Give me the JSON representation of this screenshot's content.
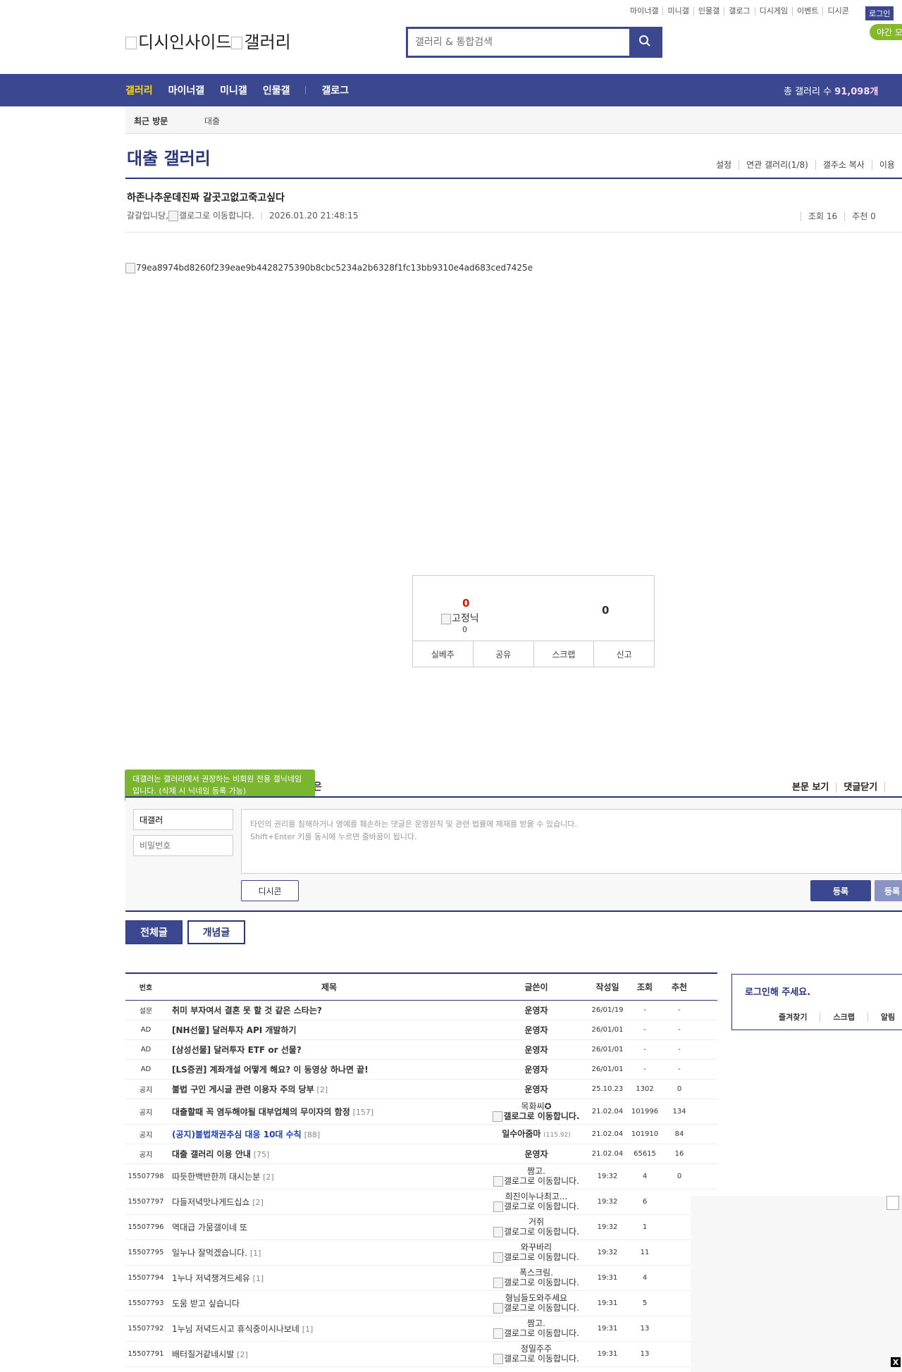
{
  "header": {
    "top_links": [
      "마이너갤",
      "미니갤",
      "인물갤",
      "갤로그",
      "디시게임",
      "이벤트",
      "디시콘"
    ],
    "login_label": "로그인",
    "night_mode_label": "야간 모드",
    "logo_alt_1": "디시인사이드",
    "logo_alt_2": "갤러리",
    "search_placeholder": "갤러리 & 통합검색",
    "search_icon": "search-icon"
  },
  "nav": {
    "items": [
      "갤러리",
      "마이너갤",
      "미니갤",
      "인물갤",
      "갤로그"
    ],
    "total_label": "총 갤러리 수 ",
    "total_value": "91,098개"
  },
  "recent": {
    "label": "최근 방문",
    "item": "대출"
  },
  "gallery": {
    "title": "대출 갤러리",
    "menu": [
      "설정",
      "연관 갤러리(1/8)",
      "갤주소 복사",
      "이용"
    ]
  },
  "post": {
    "title": "하존나추운데진짜 갈곳고없고죽고싶다",
    "author": "갈갈입니당",
    "author_img_alt": "갤로그로 이동합니다.",
    "datetime": "2026.01.20 21:48:15",
    "views": "조회 16",
    "recommends": "추천 0",
    "image_alt": "79ea8974bd8260f239eae9b4428275390b8cbc5234a2b6328f1fc13bb9310e4ad683ced7425e"
  },
  "recommend": {
    "up_count": "0",
    "fixed_alt": "고정닉",
    "fixed_count": "0",
    "down_count": "0",
    "actions": [
      "실베추",
      "공유",
      "스크랩",
      "신고"
    ]
  },
  "comment": {
    "tooltip": "대갤러는 갤러리에서 권장하는 비회원 전용 갤닉네임입니다. (삭제 시 닉네임 등록 가능)",
    "head_trunc": "은",
    "links": [
      "본문 보기",
      "댓글닫기"
    ],
    "nickname_value": "대갤러",
    "password_placeholder": "비밀번호",
    "notice_line1": "타인의 권리를 침해하거나 명예를 훼손하는 댓글은 운영원칙 및 관련 법률에 제재를 받을 수 있습니다.",
    "notice_line2": "Shift+Enter 키를 동시에 누르면 줄바꿈이 됩니다.",
    "dcon_label": "디시콘",
    "register_label": "등록",
    "register2_label": "등록"
  },
  "tabs": {
    "all": "전체글",
    "concept": "개념글"
  },
  "list": {
    "headers": [
      "번호",
      "제목",
      "글쓴이",
      "작성일",
      "조회",
      "추천"
    ],
    "rows": [
      {
        "no": "설문",
        "title": "취미 부자여서 결혼 못 할 것 같은 스타는?",
        "reply": "",
        "writer": "운영자",
        "writer_sub": "",
        "date": "26/01/19",
        "views": "-",
        "rec": "-",
        "style": "bold"
      },
      {
        "no": "AD",
        "title": "[NH선물] 달러투자 API 개발하기",
        "reply": "",
        "writer": "운영자",
        "writer_sub": "",
        "date": "26/01/01",
        "views": "-",
        "rec": "-",
        "style": "bold"
      },
      {
        "no": "AD",
        "title": "[삼성선물] 달러투자 ETF or 선물?",
        "reply": "",
        "writer": "운영자",
        "writer_sub": "",
        "date": "26/01/01",
        "views": "-",
        "rec": "-",
        "style": "bold"
      },
      {
        "no": "AD",
        "title": "[LS증권] 계좌개설 어떻게 해요? 이 동영상 하나면 끝!",
        "reply": "",
        "writer": "운영자",
        "writer_sub": "",
        "date": "26/01/01",
        "views": "-",
        "rec": "-",
        "style": "bold"
      },
      {
        "no": "공지",
        "title": "불법 구인 게시글 관련 이용자 주의 당부",
        "reply": "[2]",
        "writer": "운영자",
        "writer_sub": "",
        "date": "25.10.23",
        "views": "1302",
        "rec": "0",
        "style": "bold"
      },
      {
        "no": "공지",
        "title": "대출할때 꼭 염두해야될 대부업체의 무이자의 함정",
        "reply": "[157]",
        "writer": "목화씨✪",
        "writer_sub": "갤로그로 이동합니다.",
        "date": "21.02.04",
        "views": "101996",
        "rec": "134",
        "style": "bold"
      },
      {
        "no": "공지",
        "title": "(공지)불법채권추심 대응 10대 수칙",
        "reply": "[88]",
        "writer": "일수아줌마",
        "writer_sub": "(115.92)",
        "date": "21.02.04",
        "views": "101910",
        "rec": "84",
        "style": "blue"
      },
      {
        "no": "공지",
        "title": "대출 갤러리 이용 안내",
        "reply": "[75]",
        "writer": "운영자",
        "writer_sub": "",
        "date": "21.02.04",
        "views": "65615",
        "rec": "16",
        "style": "bold"
      },
      {
        "no": "15507798",
        "title": "따듯한백반한끼 대시는분",
        "reply": "[2]",
        "writer": "짬고.",
        "writer_sub": "갤로그로 이동합니다.",
        "date": "19:32",
        "views": "4",
        "rec": "0",
        "style": "normal"
      },
      {
        "no": "15507797",
        "title": "다들저녁맛나게드십쇼",
        "reply": "[2]",
        "writer": "희진이누나최고...",
        "writer_sub": "갤로그로 이동합니다.",
        "date": "19:32",
        "views": "6",
        "rec": "",
        "style": "normal"
      },
      {
        "no": "15507796",
        "title": "역대급 가뭄갤이네 또",
        "reply": "",
        "writer": "거쥐",
        "writer_sub": "갤로그로 이동합니다.",
        "date": "19:32",
        "views": "1",
        "rec": "",
        "style": "normal"
      },
      {
        "no": "15507795",
        "title": "일누나 잘먹겠습니다.",
        "reply": "[1]",
        "writer": "와꾸바리",
        "writer_sub": "갤로그로 이동합니다.",
        "date": "19:32",
        "views": "11",
        "rec": "",
        "style": "normal"
      },
      {
        "no": "15507794",
        "title": "1누나 저녁챙겨드세유",
        "reply": "[1]",
        "writer": "폭스크림.",
        "writer_sub": "갤로그로 이동합니다.",
        "date": "19:31",
        "views": "4",
        "rec": "",
        "style": "normal"
      },
      {
        "no": "15507793",
        "title": "도움 받고 싶습니다",
        "reply": "",
        "writer": "형님들도와주세요",
        "writer_sub": "갤로그로 이동합니다.",
        "date": "19:31",
        "views": "5",
        "rec": "",
        "style": "normal"
      },
      {
        "no": "15507792",
        "title": "1누님 저녁드시고 휴식중이시나보네",
        "reply": "[1]",
        "writer": "짬고.",
        "writer_sub": "갤로그로 이동합니다.",
        "date": "19:31",
        "views": "13",
        "rec": "",
        "style": "normal"
      },
      {
        "no": "15507791",
        "title": "배터질거같네시발",
        "reply": "[2]",
        "writer": "정밀주주",
        "writer_sub": "갤로그로 이동합니다.",
        "date": "19:31",
        "views": "13",
        "rec": "",
        "style": "normal"
      }
    ]
  },
  "sidebar": {
    "login_prompt": "로그인해 주세요.",
    "links": [
      "즐겨찾기",
      "스크랩",
      "알림"
    ],
    "close_label": "X"
  }
}
